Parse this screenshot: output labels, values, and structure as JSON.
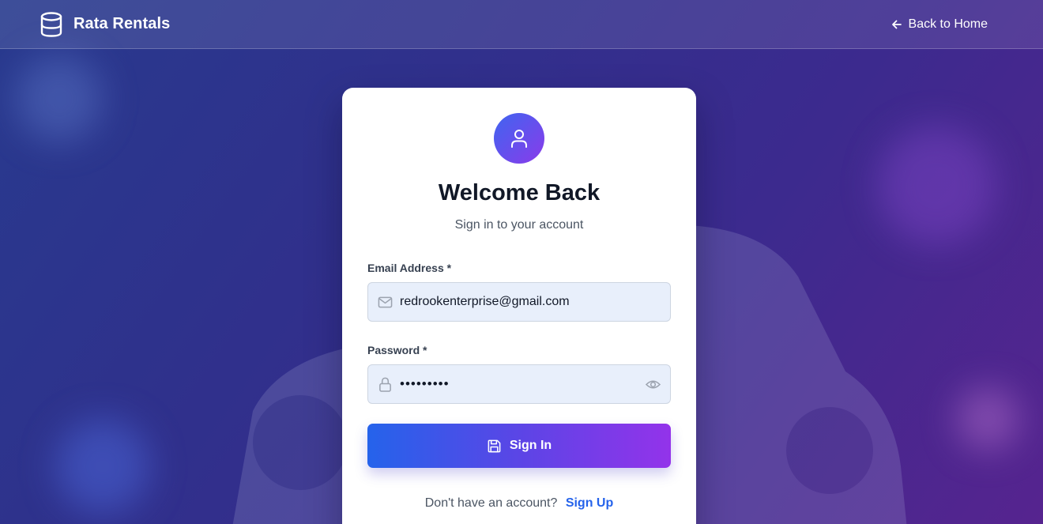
{
  "header": {
    "brand_name": "Rata Rentals",
    "back_label": "Back to Home"
  },
  "card": {
    "title": "Welcome Back",
    "subtitle": "Sign in to your account",
    "email": {
      "label": "Email Address *",
      "value": "redrookenterprise@gmail.com"
    },
    "password": {
      "label": "Password *",
      "value": "•••••••••"
    },
    "signin_label": "Sign In",
    "signup_prompt": "Don't have an account?",
    "signup_link": "Sign Up"
  },
  "icons": {
    "logo": "database-icon",
    "back": "arrow-left-icon",
    "avatar": "user-icon",
    "email": "mail-icon",
    "password": "lock-icon",
    "toggle": "eye-icon",
    "signin": "save-icon"
  },
  "colors": {
    "accent": "#2563eb",
    "gradient_start": "#2563eb",
    "gradient_end": "#9333ea",
    "input_bg": "#e8effb"
  }
}
